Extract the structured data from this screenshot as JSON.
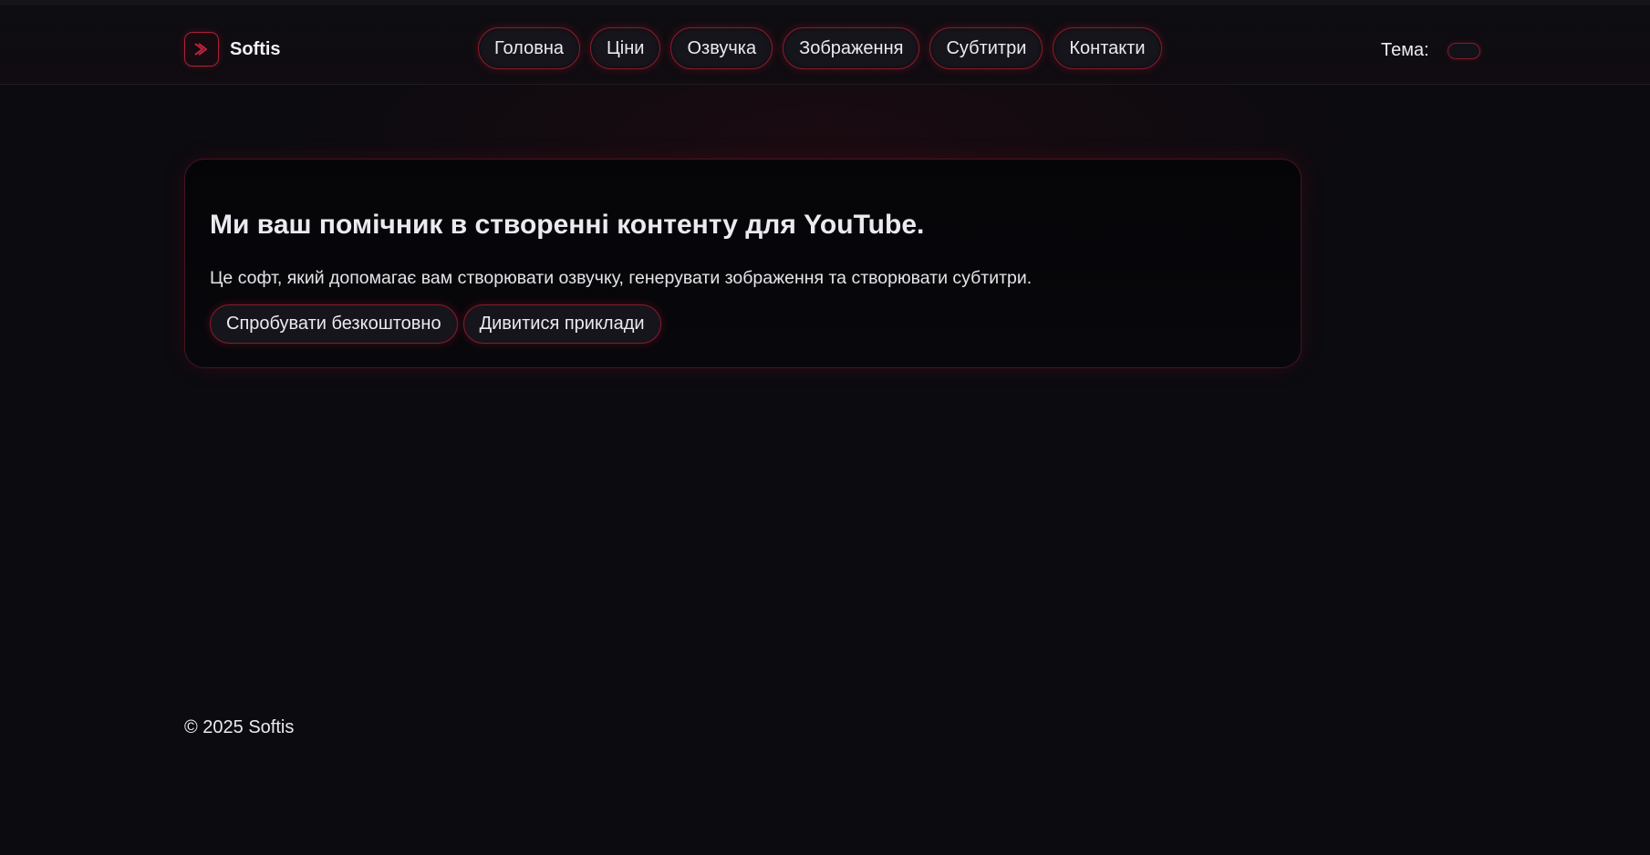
{
  "brand": {
    "name": "Softis",
    "logo_icon": "play-chevrons-icon",
    "accent_color": "#b0203a"
  },
  "nav": {
    "items": [
      {
        "label": "Головна"
      },
      {
        "label": "Ціни"
      },
      {
        "label": "Озвучка"
      },
      {
        "label": "Зображення"
      },
      {
        "label": "Субтитри"
      },
      {
        "label": "Контакти"
      }
    ]
  },
  "theme": {
    "label": "Тема:"
  },
  "hero": {
    "title": "Ми ваш помічник в створенні контенту для YouTube.",
    "description": "Це софт, який допомагає вам створювати озвучку, генерувати зображення та створювати субтитри.",
    "primary_cta": "Спробувати безкоштовно",
    "secondary_cta": "Дивитися приклади"
  },
  "footer": {
    "copyright": "© 2025 Softis"
  },
  "colors": {
    "background": "#0b0b10",
    "button_border": "#8a1a2c",
    "text": "#eceaf0"
  }
}
